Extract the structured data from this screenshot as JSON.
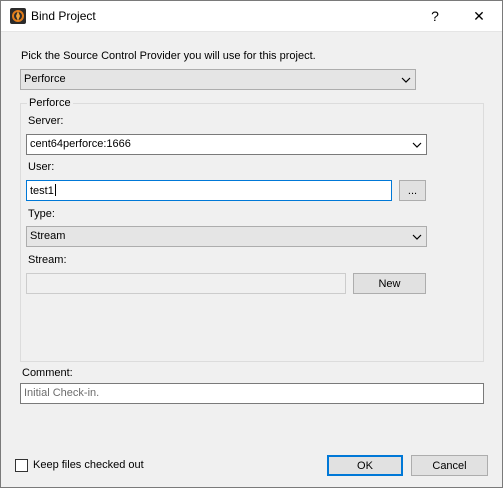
{
  "window": {
    "title": "Bind Project",
    "help_label": "?",
    "close_label": "✕"
  },
  "provider": {
    "prompt": "Pick the Source Control Provider you will use for this project.",
    "selected": "Perforce"
  },
  "perforce": {
    "group_label": "Perforce",
    "server_label": "Server:",
    "server_value": "cent64perforce:1666",
    "user_label": "User:",
    "user_value": "test1",
    "browse_label": "...",
    "type_label": "Type:",
    "type_value": "Stream",
    "stream_label": "Stream:",
    "stream_value": "",
    "new_label": "New"
  },
  "comment": {
    "label": "Comment:",
    "placeholder": "Initial Check-in."
  },
  "footer": {
    "keep_checked_out_label": "Keep files checked out",
    "keep_checked_out": false,
    "ok_label": "OK",
    "cancel_label": "Cancel"
  }
}
